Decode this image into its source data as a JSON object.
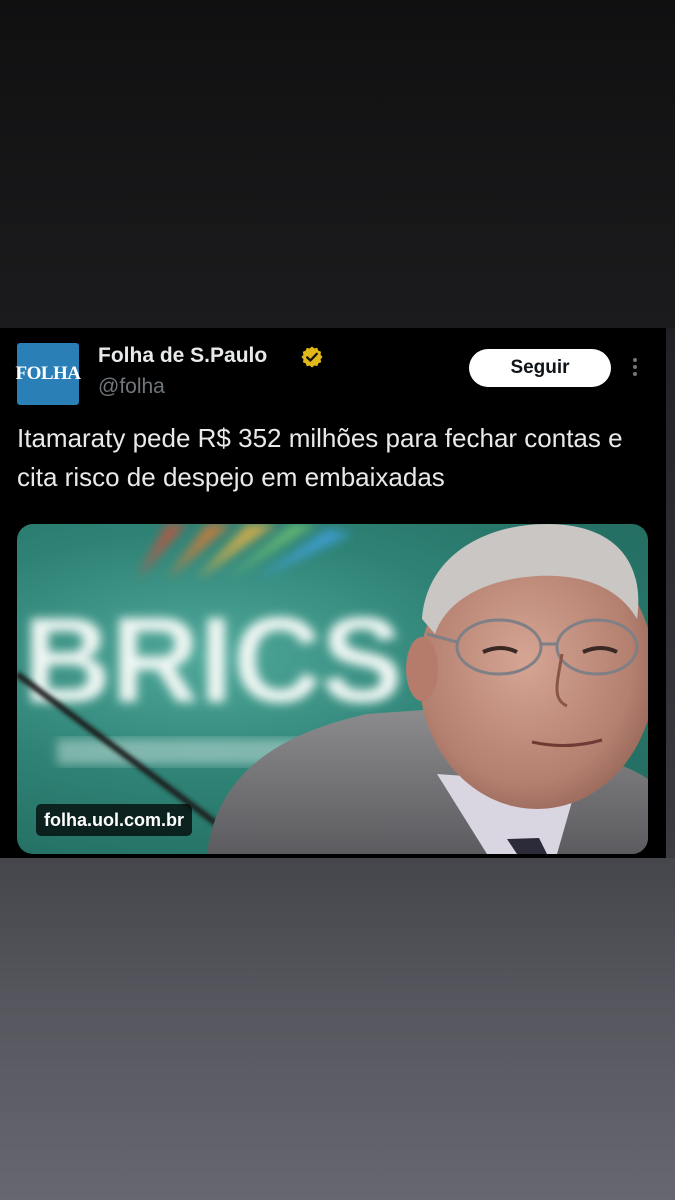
{
  "tweet": {
    "avatar_text": "FOLHA",
    "author_name": "Folha de S.Paulo",
    "handle": "@folha",
    "follow_label": "Seguir",
    "text": "Itamaraty pede R$ 352 milhões para fechar contas e cita risco de despejo em embaixadas",
    "media": {
      "background_text": "BRICS",
      "source_label": "folha.uol.com.br"
    }
  },
  "colors": {
    "card_bg": "#000000",
    "brand_blue": "#2a7fb6",
    "verified_gold": "#e2b719",
    "text_primary": "#e7e9ea",
    "text_secondary": "#71767b"
  }
}
